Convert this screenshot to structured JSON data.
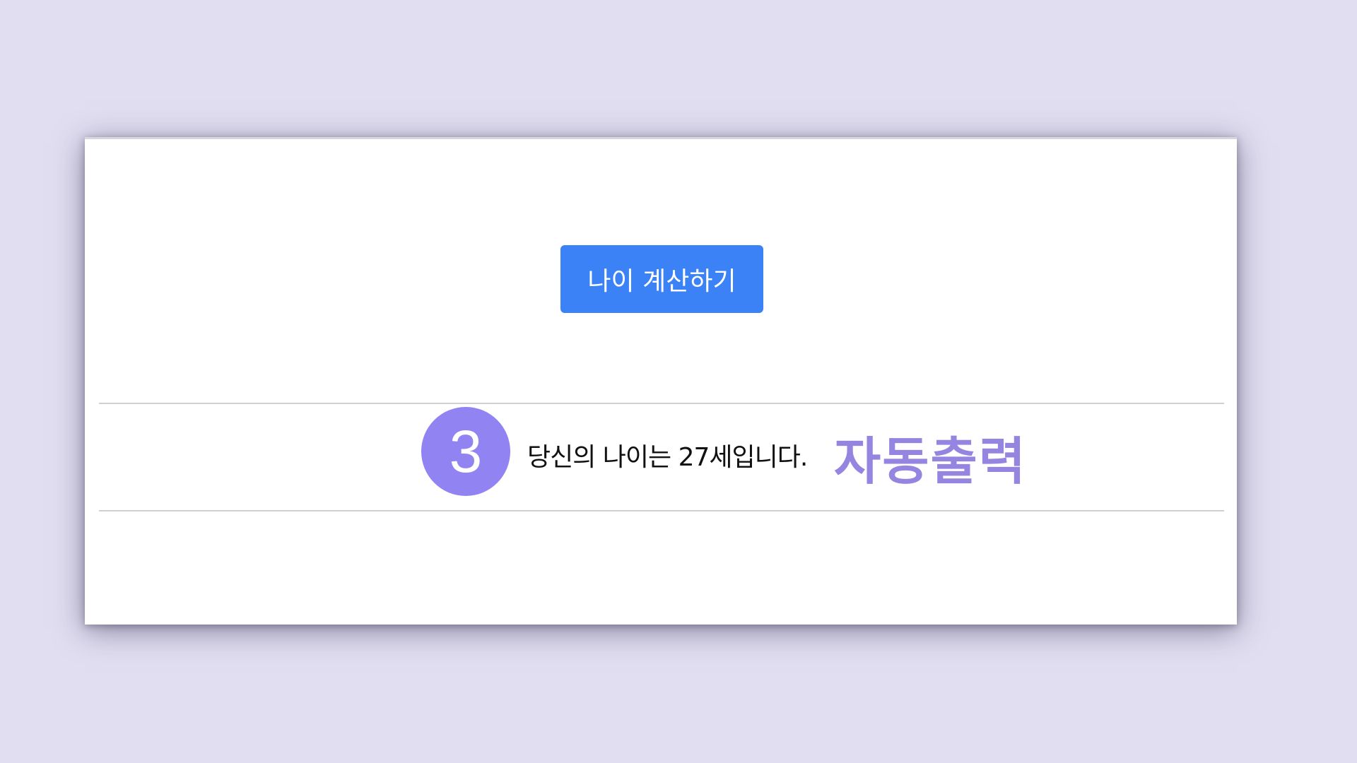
{
  "calculator": {
    "button_label": "나이 계산하기"
  },
  "result": {
    "step_number": "3",
    "message": "당신의 나이는 27세입니다.",
    "annotation": "자동출력"
  },
  "colors": {
    "background": "#e1def1",
    "button": "#3b82f6",
    "badge": "#9283f3",
    "annotation": "#9584e0"
  }
}
